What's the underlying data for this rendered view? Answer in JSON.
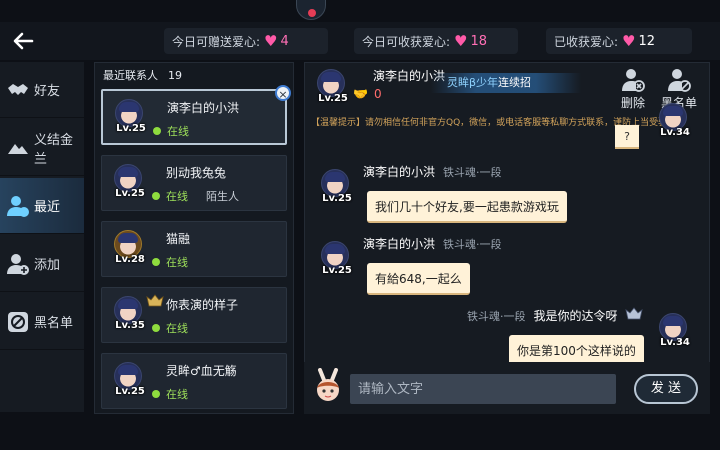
{
  "colors": {
    "accent": "#6fd0ff",
    "heart": "#ff5aa8",
    "online": "#8fdc3e",
    "bubble": "#fff2d8",
    "notice": "#d2a35b"
  },
  "header": {
    "stats": [
      {
        "label": "今日可赠送爱心:",
        "value": "4"
      },
      {
        "label": "今日可收获爱心:",
        "value": "18"
      },
      {
        "label": "已收获爱心:",
        "value": "12"
      }
    ]
  },
  "nav": {
    "items": [
      {
        "label": "好友",
        "icon": "handshake-icon"
      },
      {
        "label": "义结金兰",
        "icon": "alliance-icon"
      },
      {
        "label": "最近",
        "icon": "recent-user-icon"
      },
      {
        "label": "添加",
        "icon": "add-user-icon"
      },
      {
        "label": "黑名单",
        "icon": "blacklist-icon"
      }
    ]
  },
  "contacts": {
    "title": "最近联系人",
    "count": "19",
    "items": [
      {
        "name": "演李白的小洪",
        "status": "在线",
        "tag": "",
        "level": "Lv.25"
      },
      {
        "name": "别动我兔兔",
        "status": "在线",
        "tag": "陌生人",
        "level": "Lv.25"
      },
      {
        "name": "猫融",
        "status": "在线",
        "tag": "",
        "level": "Lv.28"
      },
      {
        "name": "你表演的样子",
        "status": "在线",
        "tag": "",
        "level": "Lv.35"
      },
      {
        "name": "灵眸♂血无觞",
        "status": "在线",
        "tag": "",
        "level": "Lv.25"
      }
    ]
  },
  "chat": {
    "partner_name": "演李白的小洪",
    "partner_level": "Lv.25",
    "intimacy": "0",
    "marquee_highlight": "灵眸β少年",
    "marquee_text": "连续招",
    "delete_label": "删除",
    "blacklist_label": "黑名单",
    "notice": "【温馨提示】请勿相信任何非官方QQ，微信，或电话客服等私聊方式联系，谨防上当受骗!",
    "messages": [
      {
        "side": "right",
        "text": "?",
        "level": "Lv.34"
      },
      {
        "side": "left",
        "name": "演李白的小洪",
        "rank": "铁斗魂·一段",
        "text": "我们几十个好友,要一起患款游戏玩",
        "level": "Lv.25"
      },
      {
        "side": "left",
        "name": "演李白的小洪",
        "rank": "铁斗魂·一段",
        "text": "有給648,一起么",
        "level": "Lv.25"
      },
      {
        "side": "right",
        "name": "我是你的达令呀",
        "rank": "铁斗魂·一段",
        "text": "你是第100个这样说的",
        "level": "Lv.34"
      }
    ]
  },
  "input": {
    "placeholder": "请输入文字",
    "send_label": "发 送"
  }
}
